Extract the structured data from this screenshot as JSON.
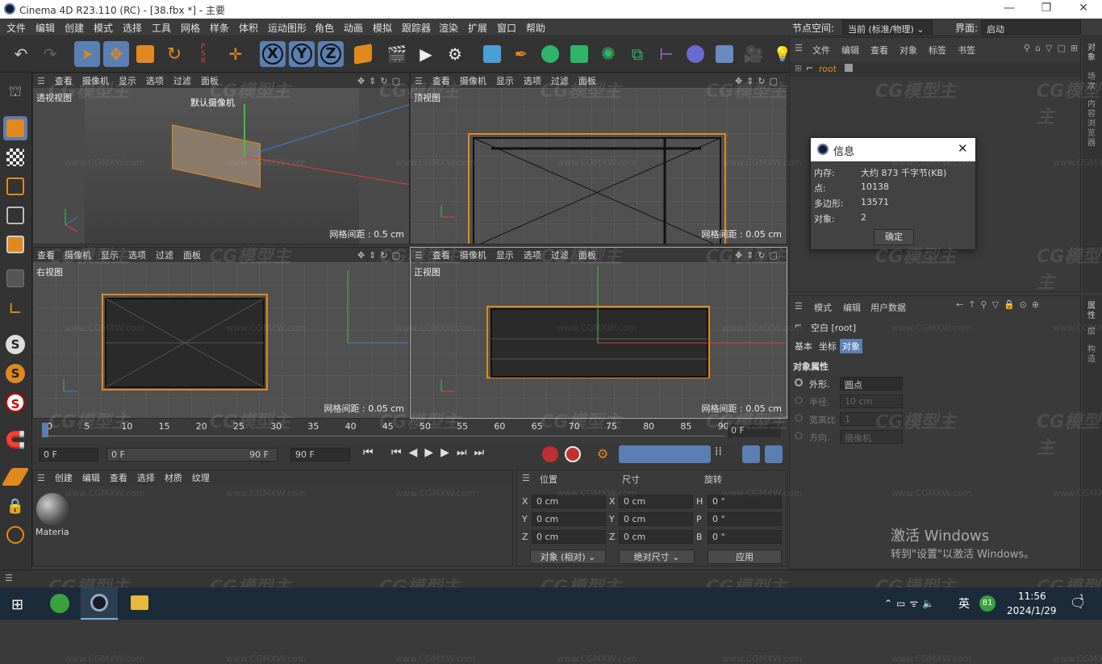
{
  "window": {
    "title": "Cinema 4D R23.110 (RC) - [38.fbx *] - 主要"
  },
  "menu": [
    "文件",
    "编辑",
    "创建",
    "模式",
    "选择",
    "工具",
    "网格",
    "样条",
    "体积",
    "运动图形",
    "角色",
    "动画",
    "模拟",
    "跟踪器",
    "渲染",
    "扩展",
    "窗口",
    "帮助"
  ],
  "node_space": {
    "label": "节点空间:",
    "value": "当前 (标准/物理)"
  },
  "layout": {
    "label": "界面:",
    "value": "启动"
  },
  "viewport_menu": [
    "查看",
    "摄像机",
    "显示",
    "选项",
    "过滤",
    "面板"
  ],
  "viewports": {
    "perspective": {
      "name": "透视视图",
      "camera": "默认摄像机",
      "grid": "网格间距 : 0.5 cm"
    },
    "top": {
      "name": "顶视图",
      "grid": "网格间距 : 0.05 cm"
    },
    "right": {
      "name": "右视图",
      "grid": "网格间距 : 0.05 cm"
    },
    "front": {
      "name": "正视图",
      "grid": "网格间距 : 0.05 cm"
    }
  },
  "timeline": {
    "ticks": [
      "0",
      "5",
      "10",
      "15",
      "20",
      "25",
      "30",
      "35",
      "40",
      "45",
      "50",
      "55",
      "60",
      "65",
      "70",
      "75",
      "80",
      "85",
      "90"
    ],
    "end_label": "0 F",
    "current": "0 F",
    "range_start": "0 F",
    "range_end": "90 F",
    "max": "90 F"
  },
  "material_panel": {
    "menu": [
      "创建",
      "编辑",
      "查看",
      "选择",
      "材质",
      "纹理"
    ],
    "material_name": "Materia"
  },
  "coord_panel": {
    "headers": [
      "位置",
      "尺寸",
      "旋转"
    ],
    "rows": [
      {
        "axis": "X",
        "pos": "0 cm",
        "saxis": "X",
        "size": "0 cm",
        "raxis": "H",
        "rot": "0 °"
      },
      {
        "axis": "Y",
        "pos": "0 cm",
        "saxis": "Y",
        "size": "0 cm",
        "raxis": "P",
        "rot": "0 °"
      },
      {
        "axis": "Z",
        "pos": "0 cm",
        "saxis": "Z",
        "size": "0 cm",
        "raxis": "B",
        "rot": "0 °"
      }
    ],
    "mode": "对象 (相对)",
    "size_mode": "绝对尺寸",
    "apply": "应用"
  },
  "object_manager": {
    "menu": [
      "文件",
      "编辑",
      "查看",
      "对象",
      "标签",
      "书签"
    ],
    "root": "root"
  },
  "info_dialog": {
    "title": "信息",
    "rows": [
      {
        "k": "内存:",
        "v": "大约 873 千字节(KB)"
      },
      {
        "k": "点:",
        "v": "10138"
      },
      {
        "k": "多边形:",
        "v": "13571"
      },
      {
        "k": "对象:",
        "v": "2"
      }
    ],
    "ok": "确定"
  },
  "attributes": {
    "menu": [
      "模式",
      "编辑",
      "用户数据"
    ],
    "object": "空白 [root]",
    "tabs": [
      "基本",
      "坐标",
      "对象"
    ],
    "active_tab": "对象",
    "section": "对象属性",
    "props": [
      {
        "label": "外形.",
        "value": "圆点"
      },
      {
        "label": "半径.",
        "value": "10 cm"
      },
      {
        "label": "宽高比",
        "value": "1"
      },
      {
        "label": "方向.",
        "value": "摄像机"
      }
    ]
  },
  "side_tabs": [
    "对象",
    "场次",
    "内容浏览器",
    "层",
    "构造"
  ],
  "side_tabs2": [
    "属性",
    "层",
    "构造"
  ],
  "watermark": {
    "brand": "CG模型主",
    "site": "www.CGMXW.com"
  },
  "activate_windows": {
    "line1": "激活 Windows",
    "line2": "转到\"设置\"以激活 Windows。"
  },
  "taskbar": {
    "time": "11:56",
    "date": "2024/1/29",
    "ime": "英",
    "badge": "81",
    "notif": "1"
  },
  "colors": {
    "accent": "#5b7fb3",
    "orange": "#e0891e",
    "x_axis": "#e04040",
    "y_axis": "#40c040",
    "z_axis": "#4080e0"
  }
}
